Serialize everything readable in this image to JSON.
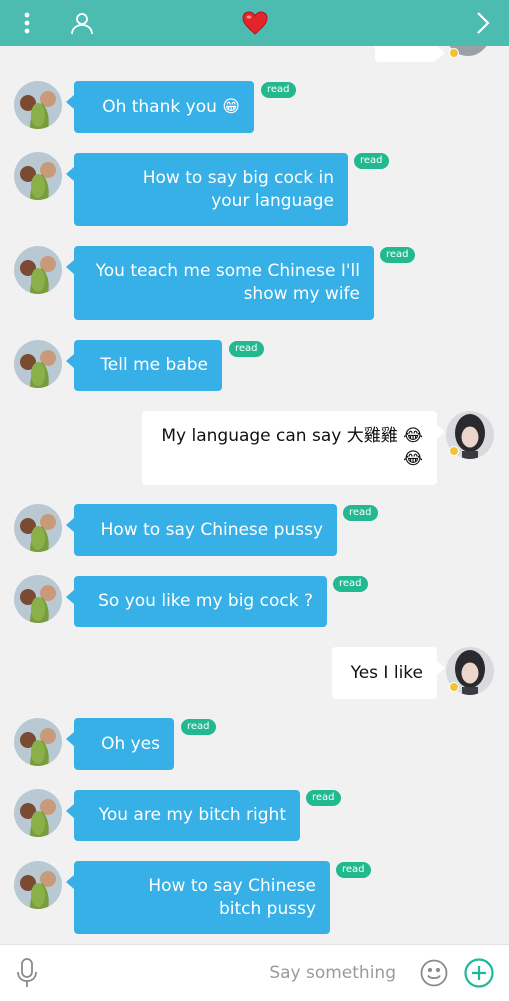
{
  "header": {
    "menu_icon": "vertical-dots-icon",
    "profile_icon": "person-icon",
    "favorite_icon": "heart-icon",
    "forward_icon": "chevron-right-icon",
    "background_color": "#4cbcb1",
    "heart_color": "#e3242b"
  },
  "messages": [
    {
      "from": "them",
      "lines": [
        "Oh thank you 😁"
      ],
      "status": "read"
    },
    {
      "from": "them",
      "lines": [
        "How to say big cock in",
        "your language"
      ],
      "status": "read"
    },
    {
      "from": "them",
      "lines": [
        "You teach me some Chinese I'll",
        "show my wife"
      ],
      "status": "read"
    },
    {
      "from": "them",
      "lines": [
        "Tell me babe"
      ],
      "status": "read"
    },
    {
      "from": "me",
      "lines": [
        "My language can say 大雞雞 😂",
        "😂"
      ]
    },
    {
      "from": "them",
      "lines": [
        "How to say Chinese pussy"
      ],
      "status": "read"
    },
    {
      "from": "them",
      "lines": [
        "So you like my big cock ?"
      ],
      "status": "read"
    },
    {
      "from": "me",
      "lines": [
        "Yes I like"
      ]
    },
    {
      "from": "them",
      "lines": [
        "Oh yes"
      ],
      "status": "read"
    },
    {
      "from": "them",
      "lines": [
        "You are my bitch right"
      ],
      "status": "read"
    },
    {
      "from": "them",
      "lines": [
        "How to say Chinese",
        "bitch pussy"
      ],
      "status": "read"
    }
  ],
  "colors": {
    "incoming_bubble": "#36b0e6",
    "outgoing_bubble": "#ffffff",
    "read_badge": "#22b890",
    "accent": "#4cbcb1"
  },
  "composer": {
    "placeholder": "Say something",
    "mic_icon": "microphone-icon",
    "emoji_icon": "smiley-icon",
    "add_icon": "plus-circle-icon"
  }
}
